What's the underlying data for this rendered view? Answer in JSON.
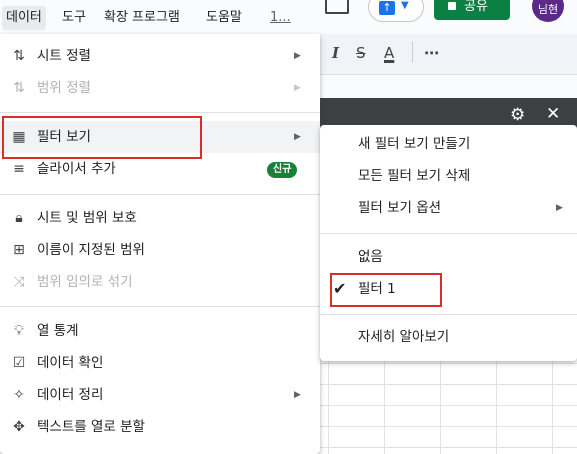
{
  "menubar": {
    "items": [
      "데이터",
      "도구",
      "확장 프로그램",
      "도움말",
      "1..."
    ]
  },
  "header": {
    "share_label": "공유",
    "avatar_initials": "님현"
  },
  "toolbar": {
    "italic": "I",
    "strikethrough": "S",
    "text_color": "A",
    "more": "⋯"
  },
  "data_menu": {
    "items": [
      {
        "label": "시트 정렬",
        "icon": "sort-icon",
        "has_submenu": true,
        "disabled": false
      },
      {
        "label": "범위 정렬",
        "icon": "sort-range-icon",
        "has_submenu": true,
        "disabled": true
      },
      {
        "label": "필터 보기",
        "icon": "filter-view-icon",
        "has_submenu": true,
        "disabled": false
      },
      {
        "label": "슬라이서 추가",
        "icon": "slicer-icon",
        "badge": "신규"
      },
      {
        "label": "시트 및 범위 보호",
        "icon": "lock-icon"
      },
      {
        "label": "이름이 지정된 범위",
        "icon": "named-range-icon"
      },
      {
        "label": "범위 임의로 섞기",
        "icon": "shuffle-icon",
        "disabled": true
      },
      {
        "label": "열 통계",
        "icon": "lightbulb-icon"
      },
      {
        "label": "데이터 확인",
        "icon": "data-validation-icon"
      },
      {
        "label": "데이터 정리",
        "icon": "magic-wand-icon",
        "has_submenu": true
      },
      {
        "label": "텍스트를 열로 분할",
        "icon": "split-columns-icon"
      }
    ]
  },
  "filter_submenu": {
    "items": [
      {
        "label": "새 필터 보기 만들기"
      },
      {
        "label": "모든 필터 보기 삭제"
      },
      {
        "label": "필터 보기 옵션",
        "has_submenu": true
      },
      {
        "label": "없음"
      },
      {
        "label": "필터 1",
        "checked": true
      },
      {
        "label": "자세히 알아보기"
      }
    ]
  },
  "colors": {
    "highlight_box": "#d93025",
    "badge": "#188038",
    "share_button": "#0b8043",
    "avatar": "#5b2a86",
    "dark_bar": "#3c4043"
  }
}
